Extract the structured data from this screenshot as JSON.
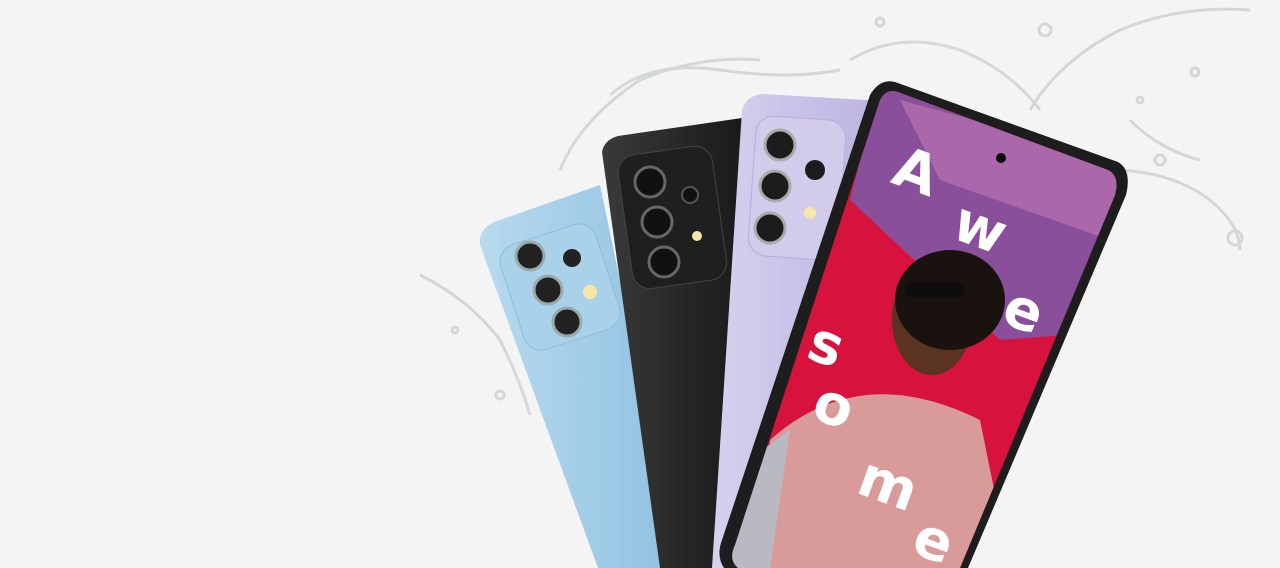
{
  "hero": {
    "colors": {
      "background": "#f4f4f4",
      "phone_blue": "#9fcbe6",
      "phone_black": "#2a2a2a",
      "phone_violet": "#c9c1e6",
      "screen_red": "#d6123d",
      "screen_purple": "#8a4f9a",
      "sweater_pink": "#d99a9a"
    },
    "phones": [
      {
        "name": "blue-phone",
        "icon": "phone-back-icon"
      },
      {
        "name": "black-phone",
        "icon": "phone-back-icon"
      },
      {
        "name": "violet-phone",
        "icon": "phone-back-icon"
      },
      {
        "name": "front-phone",
        "icon": "phone-front-icon"
      }
    ],
    "screen_text": {
      "l1": "A",
      "l2": "w",
      "l3": "e",
      "l4": "s",
      "l5": "o",
      "l6": "m",
      "l7": "e"
    }
  }
}
